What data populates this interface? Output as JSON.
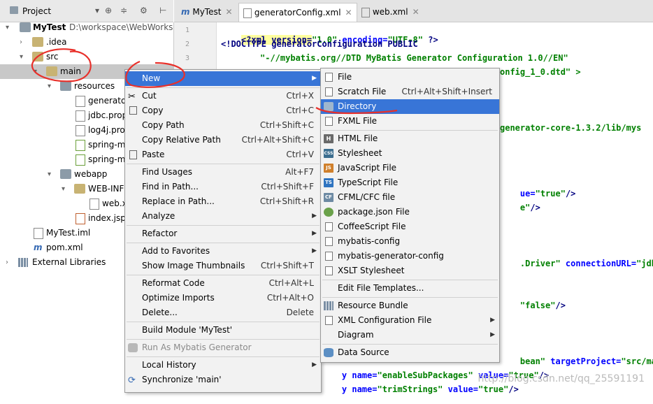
{
  "project_panel": {
    "title": "Project",
    "tree": [
      {
        "label": "MyTest",
        "path": "D:\\workspace\\WebWorks",
        "bold": true
      },
      {
        "label": ".idea"
      },
      {
        "label": "src"
      },
      {
        "label": "main"
      },
      {
        "label": "resources"
      },
      {
        "label": "generato"
      },
      {
        "label": "jdbc.prop"
      },
      {
        "label": "log4j.pro"
      },
      {
        "label": "spring-m"
      },
      {
        "label": "spring-m"
      },
      {
        "label": "webapp"
      },
      {
        "label": "WEB-INF"
      },
      {
        "label": "web.x"
      },
      {
        "label": "index.jsp"
      },
      {
        "label": "MyTest.iml"
      },
      {
        "label": "pom.xml"
      },
      {
        "label": "External Libraries"
      }
    ]
  },
  "editor": {
    "tabs": [
      {
        "label": "MyTest"
      },
      {
        "label": "generatorConfig.xml"
      },
      {
        "label": "web.xml"
      }
    ],
    "line_numbers": [
      "1",
      "2",
      "3"
    ],
    "code": {
      "l1_a": "<?xml version=",
      "l1_b": "\"1.0\"",
      "l1_c": " encoding=",
      "l1_d": "\"UTF-8\"",
      "l1_e": " ?>",
      "l2": "<!DOCTYPE generatorConfiguration PUBLIC",
      "l3": "\"-//mybatis.org//DTD MyBatis Generator Configuration 1.0//EN\"",
      "l4": "onfig_1_0.dtd\" >",
      "l5": "generator-core-1.3.2/lib/mys",
      "l6_a": "ue=",
      "l6_b": "\"true\"",
      "l6_c": "/>",
      "l7_a": "e\"",
      "l7_b": "/>",
      "l8_a": ".Driver\"",
      "l8_b": " connectionURL=",
      "l8_c": "\"jdbc",
      "l9_a": "\"false\"",
      "l9_b": "/>",
      "l10_a": "bean\"",
      "l10_b": " targetProject=",
      "l10_c": "\"src/mai",
      "l11_a": "y name=",
      "l11_b": "\"enableSubPackages\"",
      "l11_c": " value=",
      "l11_d": "\"true\"",
      "l11_e": "/>",
      "l12_a": "y name=",
      "l12_b": "\"trimStrings\"",
      "l12_c": " value=",
      "l12_d": "\"true\"",
      "l12_e": "/>"
    }
  },
  "context_menu": {
    "items": [
      {
        "label": "New",
        "shortcut": ""
      },
      {
        "label": "Cut",
        "shortcut": "Ctrl+X"
      },
      {
        "label": "Copy",
        "shortcut": "Ctrl+C"
      },
      {
        "label": "Copy Path",
        "shortcut": "Ctrl+Shift+C"
      },
      {
        "label": "Copy Relative Path",
        "shortcut": "Ctrl+Alt+Shift+C"
      },
      {
        "label": "Paste",
        "shortcut": "Ctrl+V"
      },
      {
        "label": "Find Usages",
        "shortcut": "Alt+F7"
      },
      {
        "label": "Find in Path...",
        "shortcut": "Ctrl+Shift+F"
      },
      {
        "label": "Replace in Path...",
        "shortcut": "Ctrl+Shift+R"
      },
      {
        "label": "Analyze",
        "shortcut": ""
      },
      {
        "label": "Refactor",
        "shortcut": ""
      },
      {
        "label": "Add to Favorites",
        "shortcut": ""
      },
      {
        "label": "Show Image Thumbnails",
        "shortcut": "Ctrl+Shift+T"
      },
      {
        "label": "Reformat Code",
        "shortcut": "Ctrl+Alt+L"
      },
      {
        "label": "Optimize Imports",
        "shortcut": "Ctrl+Alt+O"
      },
      {
        "label": "Delete...",
        "shortcut": "Delete"
      },
      {
        "label": "Build Module 'MyTest'",
        "shortcut": ""
      },
      {
        "label": "Run As Mybatis Generator",
        "shortcut": ""
      },
      {
        "label": "Local History",
        "shortcut": ""
      },
      {
        "label": "Synchronize 'main'",
        "shortcut": ""
      }
    ]
  },
  "new_submenu": {
    "items": [
      {
        "label": "File",
        "shortcut": ""
      },
      {
        "label": "Scratch File",
        "shortcut": "Ctrl+Alt+Shift+Insert"
      },
      {
        "label": "Directory",
        "shortcut": ""
      },
      {
        "label": "FXML File",
        "shortcut": ""
      },
      {
        "label": "HTML File",
        "shortcut": ""
      },
      {
        "label": "Stylesheet",
        "shortcut": ""
      },
      {
        "label": "JavaScript File",
        "shortcut": ""
      },
      {
        "label": "TypeScript File",
        "shortcut": ""
      },
      {
        "label": "CFML/CFC file",
        "shortcut": ""
      },
      {
        "label": "package.json File",
        "shortcut": ""
      },
      {
        "label": "CoffeeScript File",
        "shortcut": ""
      },
      {
        "label": "mybatis-config",
        "shortcut": ""
      },
      {
        "label": "mybatis-generator-config",
        "shortcut": ""
      },
      {
        "label": "XSLT Stylesheet",
        "shortcut": ""
      },
      {
        "label": "Edit File Templates...",
        "shortcut": ""
      },
      {
        "label": "Resource Bundle",
        "shortcut": ""
      },
      {
        "label": "XML Configuration File",
        "shortcut": ""
      },
      {
        "label": "Diagram",
        "shortcut": ""
      },
      {
        "label": "Data Source",
        "shortcut": ""
      }
    ]
  },
  "watermark": "http://blog.csdn.net/qq_25591191",
  "colors": {
    "selection": "#3875d7",
    "annotation": "#e8302a"
  }
}
